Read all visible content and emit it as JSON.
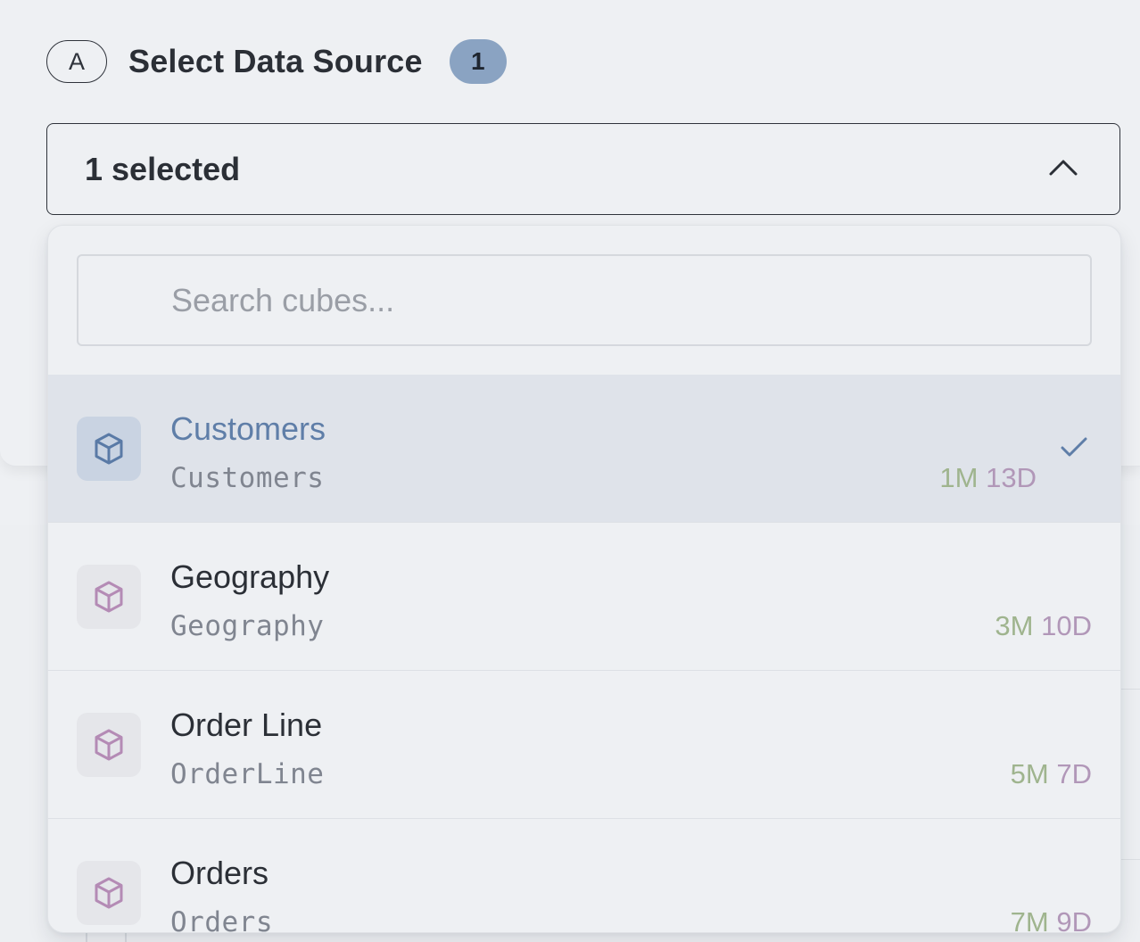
{
  "header": {
    "step_label": "A",
    "title": "Select Data Source",
    "count": "1"
  },
  "select": {
    "value": "1 selected",
    "state": "expanded"
  },
  "search": {
    "placeholder": "Search cubes...",
    "value": ""
  },
  "options": [
    {
      "name": "Customers",
      "id": "Customers",
      "age_m": "1M",
      "age_d": "13D",
      "selected": true
    },
    {
      "name": "Geography",
      "id": "Geography",
      "age_m": "3M",
      "age_d": "10D",
      "selected": false
    },
    {
      "name": "Order Line",
      "id": "OrderLine",
      "age_m": "5M",
      "age_d": "7D",
      "selected": false
    },
    {
      "name": "Orders",
      "id": "Orders",
      "age_m": "7M",
      "age_d": "9D",
      "selected": false
    }
  ],
  "icons": {
    "option_icon": "cube-icon",
    "selected_mark": "check-icon",
    "select_toggle": "chevron-up-icon"
  },
  "colors": {
    "accent": "#5f7ea8",
    "badge_bg": "#8aa3c2",
    "selected_row_bg": "#dfe3ea",
    "cube_selected": "#5a7aa6",
    "cube_default": "#b48bb5",
    "age_months": "#9fb48e",
    "age_days": "#b197b8"
  }
}
